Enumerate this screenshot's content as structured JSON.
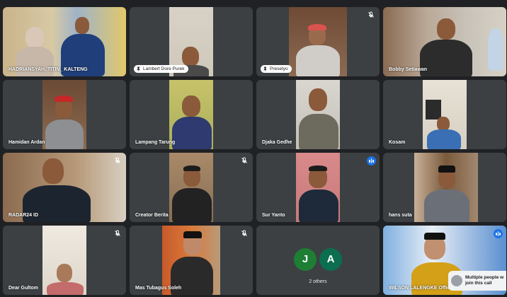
{
  "tiles": [
    {
      "name": "HADRIANSYAH, TITIN_ KALTENG",
      "label_style": "text",
      "muted": false,
      "speaking": false
    },
    {
      "name": "Lambert Dore Purek",
      "label_style": "pill",
      "muted": false,
      "speaking": false
    },
    {
      "name": "Presetyo",
      "label_style": "pill",
      "muted": true,
      "speaking": false
    },
    {
      "name": "Bobby Setiawan",
      "label_style": "text",
      "muted": false,
      "speaking": false
    },
    {
      "name": "Hamidan Ardan",
      "label_style": "text",
      "muted": false,
      "speaking": false
    },
    {
      "name": "Lampang Tarung",
      "label_style": "text",
      "muted": false,
      "speaking": false
    },
    {
      "name": "Djaka Gedhe",
      "label_style": "text",
      "muted": false,
      "speaking": false
    },
    {
      "name": "Kosam",
      "label_style": "text",
      "muted": false,
      "speaking": false
    },
    {
      "name": "RADAR24 ID",
      "label_style": "text",
      "muted": true,
      "speaking": false
    },
    {
      "name": "Creator Berita",
      "label_style": "text",
      "muted": true,
      "speaking": false
    },
    {
      "name": "Sur Yanto",
      "label_style": "text",
      "muted": false,
      "speaking": true
    },
    {
      "name": "hans suta",
      "label_style": "text",
      "muted": false,
      "speaking": false
    },
    {
      "name": "Dear Gultom",
      "label_style": "text",
      "muted": true,
      "speaking": false
    },
    {
      "name": "Mas Tubagus Soleh",
      "label_style": "text",
      "muted": true,
      "speaking": false
    },
    {
      "name": "WILSON LALENGKE Offic",
      "label_style": "text",
      "muted": false,
      "speaking": true
    }
  ],
  "others": {
    "avatars": [
      {
        "initial": "J",
        "color": "#1e7e34"
      },
      {
        "initial": "A",
        "color": "#0b6e4f"
      }
    ],
    "label": "2 others"
  },
  "toast": {
    "line1": "Multiple people w",
    "line2": "join this call"
  },
  "colors": {
    "background": "#202124",
    "tile": "#3c4043",
    "speaking_blue": "#1a73e8",
    "active_outline": "#8ab4f8"
  }
}
